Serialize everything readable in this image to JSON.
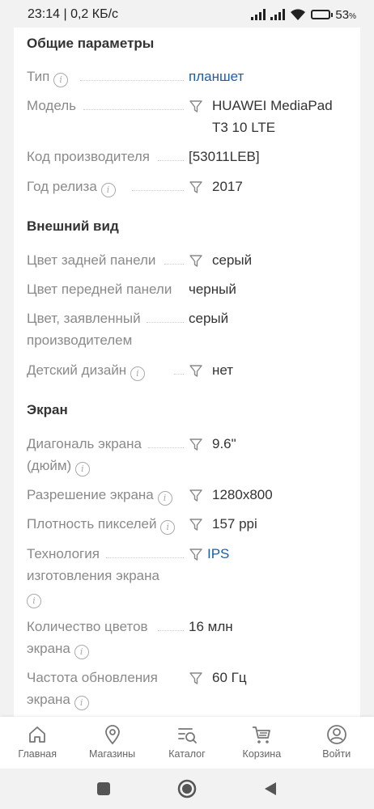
{
  "status_bar": {
    "time_speed": "23:14 | 0,2 КБ/с",
    "battery_percent": "53",
    "battery_unit": "%",
    "battery_level": 0.53
  },
  "sections": {
    "general": {
      "title": "Общие параметры",
      "rows": [
        {
          "label": "Тип",
          "value": "планшет"
        },
        {
          "label": "Модель",
          "value": "HUAWEI MediaPad T3 10 LTE"
        },
        {
          "label": "Код производителя",
          "value": "[53011LEB]"
        },
        {
          "label": "Год релиза",
          "value": "2017"
        }
      ]
    },
    "appearance": {
      "title": "Внешний вид",
      "rows": [
        {
          "label": "Цвет задней панели",
          "value": "серый"
        },
        {
          "label": "Цвет передней панели",
          "value": "черный"
        },
        {
          "label": "Цвет, заявленный производителем",
          "value": "серый"
        },
        {
          "label": "Детский дизайн",
          "value": "нет"
        }
      ]
    },
    "screen": {
      "title": "Экран",
      "rows": [
        {
          "label": "Диагональ экрана (дюйм)",
          "value": "9.6\""
        },
        {
          "label": "Разрешение экрана",
          "value": "1280x800"
        },
        {
          "label": "Плотность пикселей",
          "value": "157 ppi"
        },
        {
          "label": "Технология изготовления экрана",
          "value": "IPS"
        },
        {
          "label": "Количество цветов экрана",
          "value": "16 млн"
        },
        {
          "label": "Частота обновления экрана",
          "value": "60 Гц"
        }
      ]
    }
  },
  "bottom_nav": [
    {
      "label": "Главная",
      "icon": "home-icon"
    },
    {
      "label": "Магазины",
      "icon": "location-pin-icon"
    },
    {
      "label": "Каталог",
      "icon": "catalog-search-icon"
    },
    {
      "label": "Корзина",
      "icon": "cart-icon"
    },
    {
      "label": "Войти",
      "icon": "user-icon"
    }
  ],
  "colors": {
    "link": "#1a5fa8",
    "label": "#8a8a8a",
    "value": "#333333",
    "background": "#f2f2f2"
  }
}
